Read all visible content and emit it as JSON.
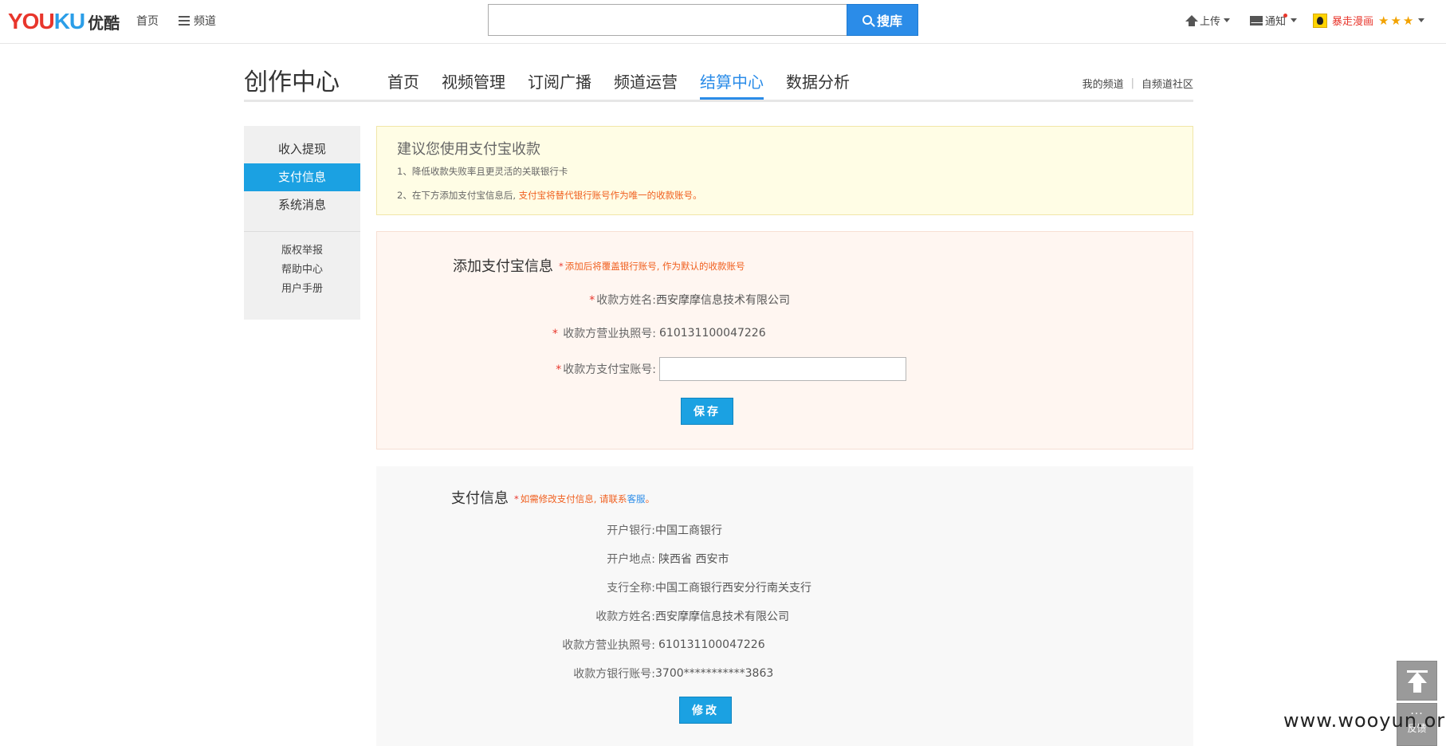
{
  "topbar": {
    "logo_en_part1": "YOU",
    "logo_en_part2": "KU",
    "logo_cn": "优酷",
    "home_link": "首页",
    "channel_link": "频道",
    "search_placeholder": "",
    "search_button": "搜库",
    "upload": "上传",
    "notify": "通知",
    "username": "暴走漫画",
    "accent_color": "#2b8ce8"
  },
  "header": {
    "title": "创作中心",
    "tabs": [
      {
        "label": "首页"
      },
      {
        "label": "视频管理"
      },
      {
        "label": "订阅广播"
      },
      {
        "label": "频道运营"
      },
      {
        "label": "结算中心"
      },
      {
        "label": "数据分析"
      }
    ],
    "active_tab": "结算中心",
    "link_my_channel": "我的频道",
    "link_community": "自频道社区"
  },
  "sidebar": {
    "items": [
      {
        "label": "收入提现"
      },
      {
        "label": "支付信息"
      },
      {
        "label": "系统消息"
      }
    ],
    "sub_items": [
      {
        "label": "版权举报"
      },
      {
        "label": "帮助中心"
      },
      {
        "label": "用户手册"
      }
    ]
  },
  "tip": {
    "title": "建议您使用支付宝收款",
    "line1": "1、降低收款失败率且更灵活的关联银行卡",
    "line2_prefix": "2、在下方添加支付宝信息后,",
    "line2_highlight": "支付宝将替代银行账号作为唯一的收款账号。"
  },
  "alipay_form": {
    "title": "添加支付宝信息",
    "note": "添加后将覆盖银行账号, 作为默认的收款账号",
    "name_label": "收款方姓名:",
    "name_value": "西安摩摩信息技术有限公司",
    "license_label": "收款方营业执照号:",
    "license_value": "610131100047226",
    "account_label": "收款方支付宝账号:",
    "account_value": "",
    "save_button": "保存"
  },
  "payment_info": {
    "title": "支付信息",
    "note_prefix": "如需修改支付信息, 请联系",
    "note_link": "客服",
    "note_suffix": "。",
    "rows": [
      {
        "label": "开户银行:",
        "value": "中国工商银行"
      },
      {
        "label": "开户地点:",
        "value": "陕西省 西安市"
      },
      {
        "label": "支行全称:",
        "value": "中国工商银行西安分行南关支行"
      },
      {
        "label": "收款方姓名:",
        "value": "西安摩摩信息技术有限公司"
      },
      {
        "label": "收款方营业执照号:",
        "value": "610131100047226"
      },
      {
        "label": "收款方银行账号:",
        "value": "3700***********3863"
      }
    ],
    "edit_button": "修改"
  },
  "widgets": {
    "feedback": "反馈",
    "watermark": "www.wooyun.org"
  }
}
